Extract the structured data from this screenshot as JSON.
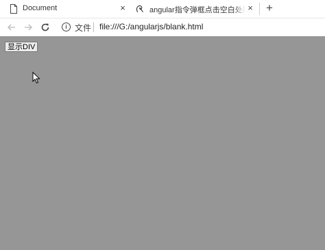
{
  "tabs": [
    {
      "title": "Document",
      "icon": "document-icon",
      "active": true
    },
    {
      "title": "angular指令弹框点击空白处隐藏",
      "icon": "angular-logo-icon",
      "active": false
    }
  ],
  "new_tab_label": "+",
  "close_label": "×",
  "toolbar": {
    "back_icon": "arrow-left-icon",
    "forward_icon": "arrow-right-icon",
    "reload_icon": "reload-icon",
    "site_label": "文件",
    "url": "file:///G:/angularjs/blank.html"
  },
  "page": {
    "button_label": "显示DIV",
    "background": "#969696"
  }
}
